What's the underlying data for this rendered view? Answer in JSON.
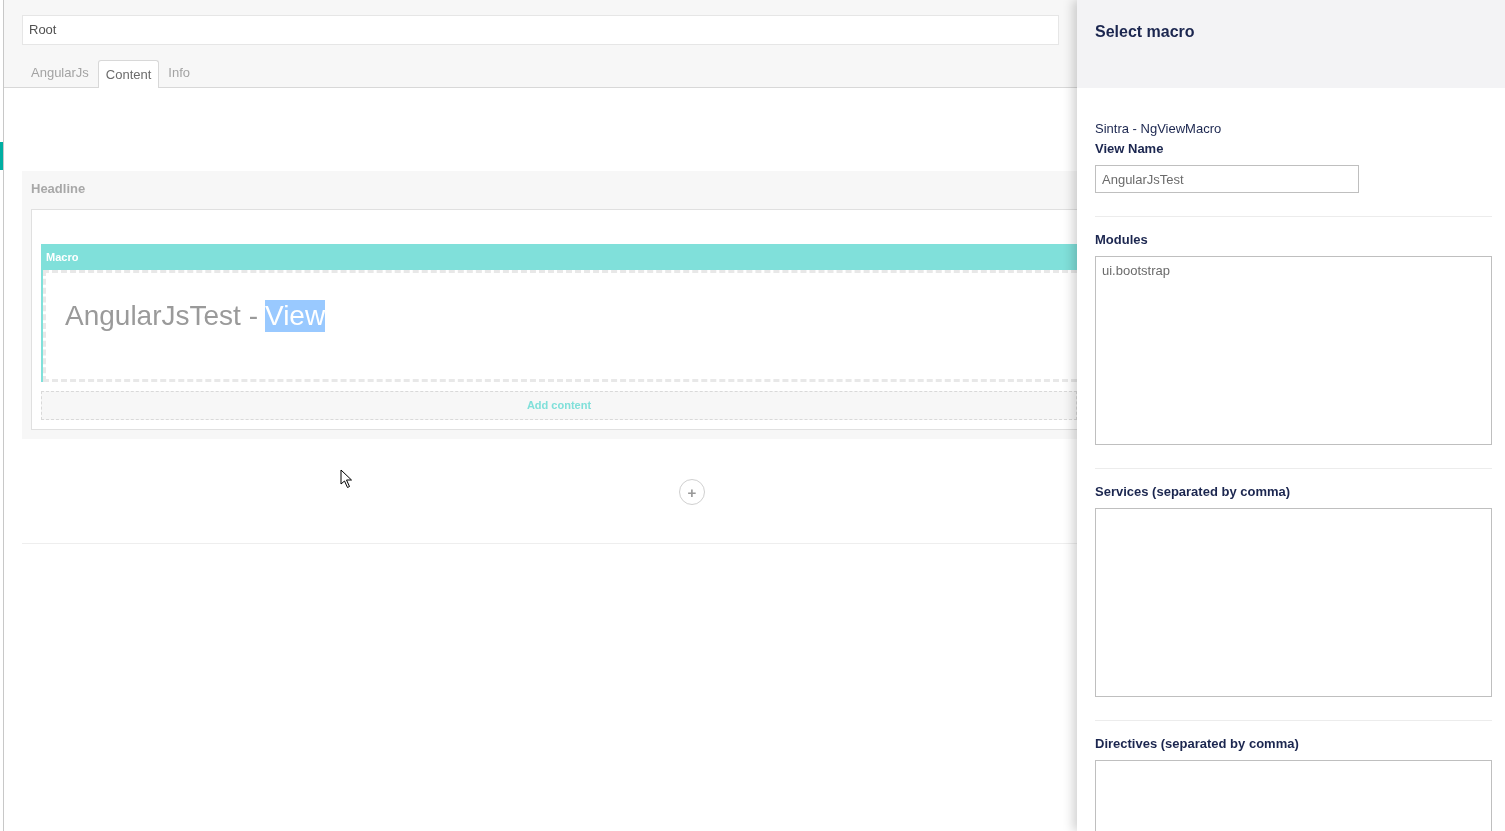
{
  "node_name": "Root",
  "tabs": [
    {
      "label": "AngularJs",
      "selected": false
    },
    {
      "label": "Content",
      "selected": true
    },
    {
      "label": "Info",
      "selected": false
    }
  ],
  "section": {
    "title": "Headline",
    "macro": {
      "header": "Macro",
      "title_parts": [
        {
          "text": "AngularJsTest -",
          "selected": false
        },
        {
          "text": "View",
          "selected": true
        }
      ]
    },
    "add_content": "Add content",
    "add_row": "+"
  },
  "panel": {
    "title": "Select macro",
    "macro_name": "Sintra - NgViewMacro",
    "fields": [
      {
        "kind": "input",
        "label": "View Name",
        "value": "AngularJsTest"
      },
      {
        "kind": "textarea",
        "label": "Modules",
        "value": "ui.bootstrap"
      },
      {
        "kind": "textarea",
        "label": "Services (separated by comma)"
      },
      {
        "kind": "textarea",
        "label": "Directives (separated by comma)"
      }
    ]
  }
}
